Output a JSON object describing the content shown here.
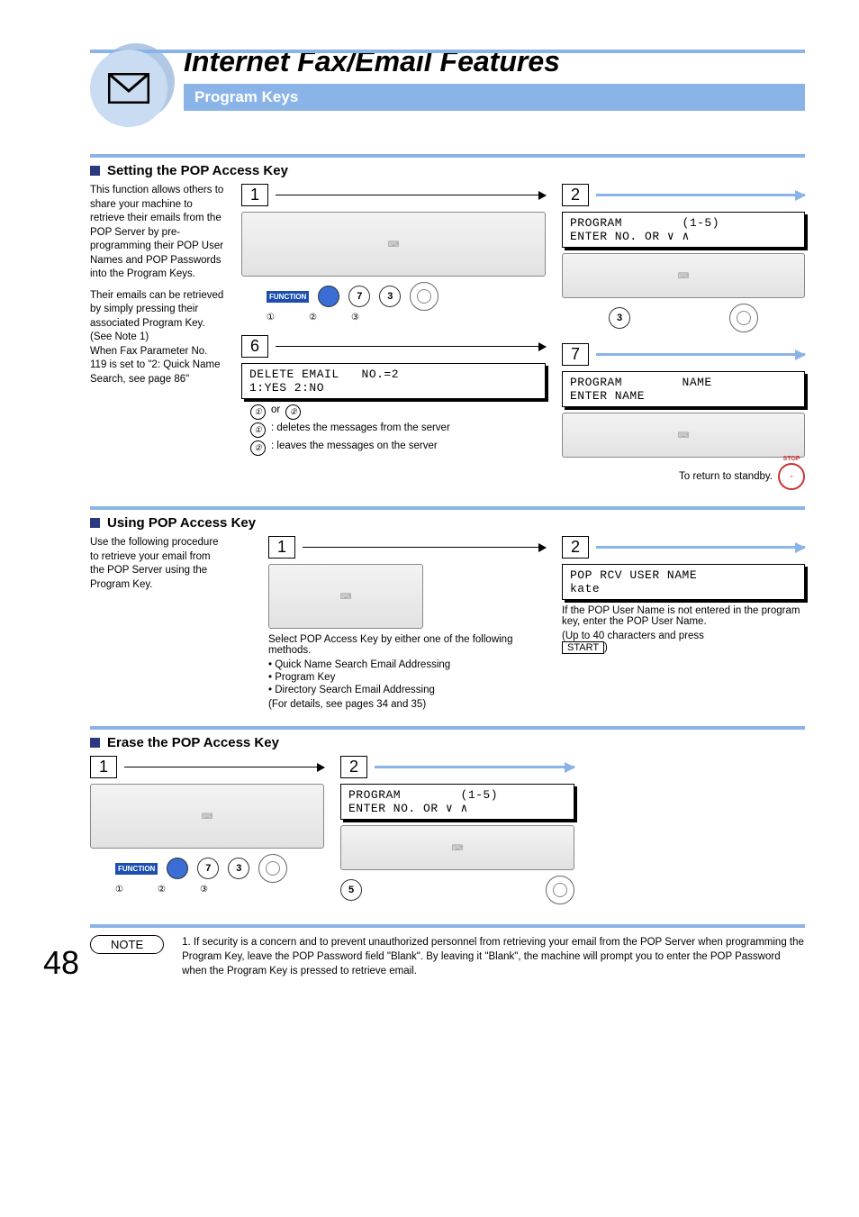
{
  "header": {
    "title": "Internet Fax/Email Features",
    "subtitle": "Program Keys"
  },
  "pageNumber": "48",
  "section1": {
    "title": "Setting the POP Access Key",
    "side_p1": "This function allows others to share your machine to retrieve their emails from the POP Server by pre-programming their POP User Names and POP Passwords into the Program Keys.",
    "side_p2a": "Their emails can be retrieved by simply pressing their associated Program Key.",
    "side_p2b": "(See Note 1)",
    "side_p2c": "When Fax Parameter No. 119 is set to \"2: Quick Name Search, see page 86\"",
    "step1": "1",
    "step2": "2",
    "step6": "6",
    "step7": "7",
    "fn_label": "FUNCTION",
    "btn7": "7",
    "btn3": "3",
    "cap1": "①",
    "cap2": "②",
    "cap3": "③",
    "lcd2_l1": "PROGRAM        (1-5)",
    "lcd2_l2": "ENTER NO. OR ∨ ∧",
    "btn3b": "3",
    "lcd6_l1": "DELETE EMAIL   NO.=2",
    "lcd6_l2": "1:YES 2:NO",
    "or_text": "or",
    "opt1_c": "①",
    "opt2_c": "②",
    "opt1": ": deletes the messages from the server",
    "opt2": ": leaves the messages on the server",
    "lcd7_l1": "PROGRAM        NAME ",
    "lcd7_l2": "ENTER NAME",
    "return_text": "To return to standby.",
    "stop": "STOP"
  },
  "section2": {
    "title": "Using POP Access Key",
    "side": "Use the following procedure to retrieve your email from the POP Server using the Program Key.",
    "step1": "1",
    "step2": "2",
    "mid_p1": "Select POP Access Key by either one of the following methods.",
    "mid_b1": "• Quick Name Search Email Addressing",
    "mid_b2": "• Program Key",
    "mid_b3": "• Directory Search Email Addressing",
    "mid_p2": "(For details, see pages 34 and 35)",
    "lcd_l1": "POP RCV USER NAME",
    "lcd_l2": "kate",
    "r_p1": "If the POP User Name is not entered in the program key, enter the POP User Name.",
    "r_p2": "(Up to 40 characters and press",
    "start": "START",
    "r_close": ")"
  },
  "section3": {
    "title": "Erase the POP Access Key",
    "step1": "1",
    "step2": "2",
    "fn_label": "FUNCTION",
    "btn7": "7",
    "btn3": "3",
    "cap1": "①",
    "cap2": "②",
    "cap3": "③",
    "lcd_l1": "PROGRAM        (1-5)",
    "lcd_l2": "ENTER NO. OR ∨ ∧",
    "btn5": "5"
  },
  "note": {
    "label": "NOTE",
    "num": "1.",
    "text": "If security is a concern and to prevent unauthorized personnel from retrieving your email from the POP Server when programming the Program Key, leave the POP Password field \"Blank\". By leaving it \"Blank\", the machine will prompt you to enter the POP Password when the Program Key is pressed to retrieve email."
  }
}
